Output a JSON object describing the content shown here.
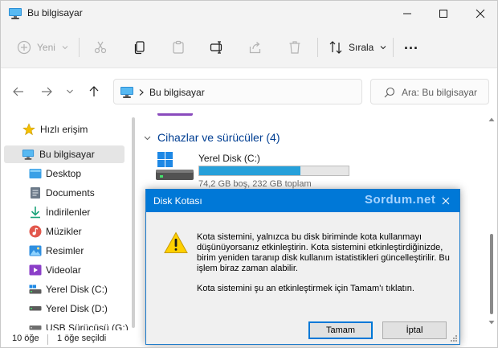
{
  "window": {
    "title": "Bu bilgisayar"
  },
  "toolbar": {
    "new_label": "Yeni",
    "sort_label": "Sırala",
    "more_label": "..."
  },
  "address": {
    "path": "Bu bilgisayar",
    "search_placeholder": "Ara: Bu bilgisayar"
  },
  "sidebar": {
    "items": [
      {
        "label": "Hızlı erişim",
        "icon": "star-icon"
      },
      {
        "label": "Bu bilgisayar",
        "icon": "computer-icon",
        "selected": true
      },
      {
        "label": "Desktop",
        "icon": "desktop-folder-icon"
      },
      {
        "label": "Documents",
        "icon": "documents-folder-icon"
      },
      {
        "label": "İndirilenler",
        "icon": "download-icon"
      },
      {
        "label": "Müzikler",
        "icon": "music-icon"
      },
      {
        "label": "Resimler",
        "icon": "pictures-icon"
      },
      {
        "label": "Videolar",
        "icon": "videos-icon"
      },
      {
        "label": "Yerel Disk (C:)",
        "icon": "drive-icon"
      },
      {
        "label": "Yerel Disk (D:)",
        "icon": "drive-icon"
      },
      {
        "label": "USB Sürücüsü (G:)",
        "icon": "usb-drive-icon"
      }
    ]
  },
  "content": {
    "group_title": "Cihazlar ve sürücüler (4)",
    "drive": {
      "name": "Yerel Disk (C:)",
      "space_text": "74,2 GB boş, 232 GB toplam",
      "used_fraction": 0.68
    }
  },
  "status": {
    "item_count": "10 öğe",
    "selected_count": "1 öğe seçildi"
  },
  "dialog": {
    "title": "Disk Kotası",
    "watermark": "Sordum.net",
    "message": "Kota sistemini, yalnızca bu disk biriminde kota kullanmayı düşünüyorsanız etkinleştirin. Kota sistemini etkinleştirdiğinizde, birim yeniden taranıp disk kullanım istatistikleri güncelleştirilir. Bu işlem biraz zaman alabilir.",
    "message2": "Kota sistemini şu an etkinleştirmek için Tamam'ı tıklatın.",
    "ok_label": "Tamam",
    "cancel_label": "İptal"
  },
  "colors": {
    "accent": "#0078d7",
    "drive_bar": "#26a0da",
    "group_heading": "#003e92"
  }
}
